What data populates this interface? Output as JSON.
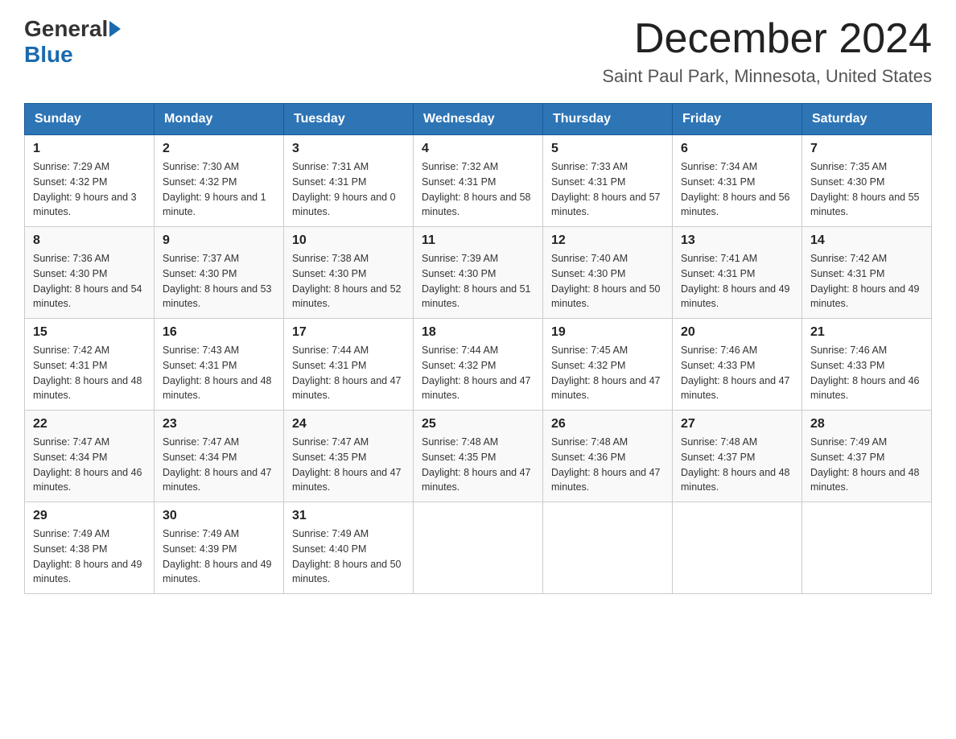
{
  "logo": {
    "general": "General",
    "blue": "Blue"
  },
  "title": "December 2024",
  "subtitle": "Saint Paul Park, Minnesota, United States",
  "days_of_week": [
    "Sunday",
    "Monday",
    "Tuesday",
    "Wednesday",
    "Thursday",
    "Friday",
    "Saturday"
  ],
  "weeks": [
    [
      {
        "day": "1",
        "sunrise": "7:29 AM",
        "sunset": "4:32 PM",
        "daylight": "9 hours and 3 minutes."
      },
      {
        "day": "2",
        "sunrise": "7:30 AM",
        "sunset": "4:32 PM",
        "daylight": "9 hours and 1 minute."
      },
      {
        "day": "3",
        "sunrise": "7:31 AM",
        "sunset": "4:31 PM",
        "daylight": "9 hours and 0 minutes."
      },
      {
        "day": "4",
        "sunrise": "7:32 AM",
        "sunset": "4:31 PM",
        "daylight": "8 hours and 58 minutes."
      },
      {
        "day": "5",
        "sunrise": "7:33 AM",
        "sunset": "4:31 PM",
        "daylight": "8 hours and 57 minutes."
      },
      {
        "day": "6",
        "sunrise": "7:34 AM",
        "sunset": "4:31 PM",
        "daylight": "8 hours and 56 minutes."
      },
      {
        "day": "7",
        "sunrise": "7:35 AM",
        "sunset": "4:30 PM",
        "daylight": "8 hours and 55 minutes."
      }
    ],
    [
      {
        "day": "8",
        "sunrise": "7:36 AM",
        "sunset": "4:30 PM",
        "daylight": "8 hours and 54 minutes."
      },
      {
        "day": "9",
        "sunrise": "7:37 AM",
        "sunset": "4:30 PM",
        "daylight": "8 hours and 53 minutes."
      },
      {
        "day": "10",
        "sunrise": "7:38 AM",
        "sunset": "4:30 PM",
        "daylight": "8 hours and 52 minutes."
      },
      {
        "day": "11",
        "sunrise": "7:39 AM",
        "sunset": "4:30 PM",
        "daylight": "8 hours and 51 minutes."
      },
      {
        "day": "12",
        "sunrise": "7:40 AM",
        "sunset": "4:30 PM",
        "daylight": "8 hours and 50 minutes."
      },
      {
        "day": "13",
        "sunrise": "7:41 AM",
        "sunset": "4:31 PM",
        "daylight": "8 hours and 49 minutes."
      },
      {
        "day": "14",
        "sunrise": "7:42 AM",
        "sunset": "4:31 PM",
        "daylight": "8 hours and 49 minutes."
      }
    ],
    [
      {
        "day": "15",
        "sunrise": "7:42 AM",
        "sunset": "4:31 PM",
        "daylight": "8 hours and 48 minutes."
      },
      {
        "day": "16",
        "sunrise": "7:43 AM",
        "sunset": "4:31 PM",
        "daylight": "8 hours and 48 minutes."
      },
      {
        "day": "17",
        "sunrise": "7:44 AM",
        "sunset": "4:31 PM",
        "daylight": "8 hours and 47 minutes."
      },
      {
        "day": "18",
        "sunrise": "7:44 AM",
        "sunset": "4:32 PM",
        "daylight": "8 hours and 47 minutes."
      },
      {
        "day": "19",
        "sunrise": "7:45 AM",
        "sunset": "4:32 PM",
        "daylight": "8 hours and 47 minutes."
      },
      {
        "day": "20",
        "sunrise": "7:46 AM",
        "sunset": "4:33 PM",
        "daylight": "8 hours and 47 minutes."
      },
      {
        "day": "21",
        "sunrise": "7:46 AM",
        "sunset": "4:33 PM",
        "daylight": "8 hours and 46 minutes."
      }
    ],
    [
      {
        "day": "22",
        "sunrise": "7:47 AM",
        "sunset": "4:34 PM",
        "daylight": "8 hours and 46 minutes."
      },
      {
        "day": "23",
        "sunrise": "7:47 AM",
        "sunset": "4:34 PM",
        "daylight": "8 hours and 47 minutes."
      },
      {
        "day": "24",
        "sunrise": "7:47 AM",
        "sunset": "4:35 PM",
        "daylight": "8 hours and 47 minutes."
      },
      {
        "day": "25",
        "sunrise": "7:48 AM",
        "sunset": "4:35 PM",
        "daylight": "8 hours and 47 minutes."
      },
      {
        "day": "26",
        "sunrise": "7:48 AM",
        "sunset": "4:36 PM",
        "daylight": "8 hours and 47 minutes."
      },
      {
        "day": "27",
        "sunrise": "7:48 AM",
        "sunset": "4:37 PM",
        "daylight": "8 hours and 48 minutes."
      },
      {
        "day": "28",
        "sunrise": "7:49 AM",
        "sunset": "4:37 PM",
        "daylight": "8 hours and 48 minutes."
      }
    ],
    [
      {
        "day": "29",
        "sunrise": "7:49 AM",
        "sunset": "4:38 PM",
        "daylight": "8 hours and 49 minutes."
      },
      {
        "day": "30",
        "sunrise": "7:49 AM",
        "sunset": "4:39 PM",
        "daylight": "8 hours and 49 minutes."
      },
      {
        "day": "31",
        "sunrise": "7:49 AM",
        "sunset": "4:40 PM",
        "daylight": "8 hours and 50 minutes."
      },
      null,
      null,
      null,
      null
    ]
  ],
  "labels": {
    "sunrise": "Sunrise:",
    "sunset": "Sunset:",
    "daylight": "Daylight:"
  }
}
